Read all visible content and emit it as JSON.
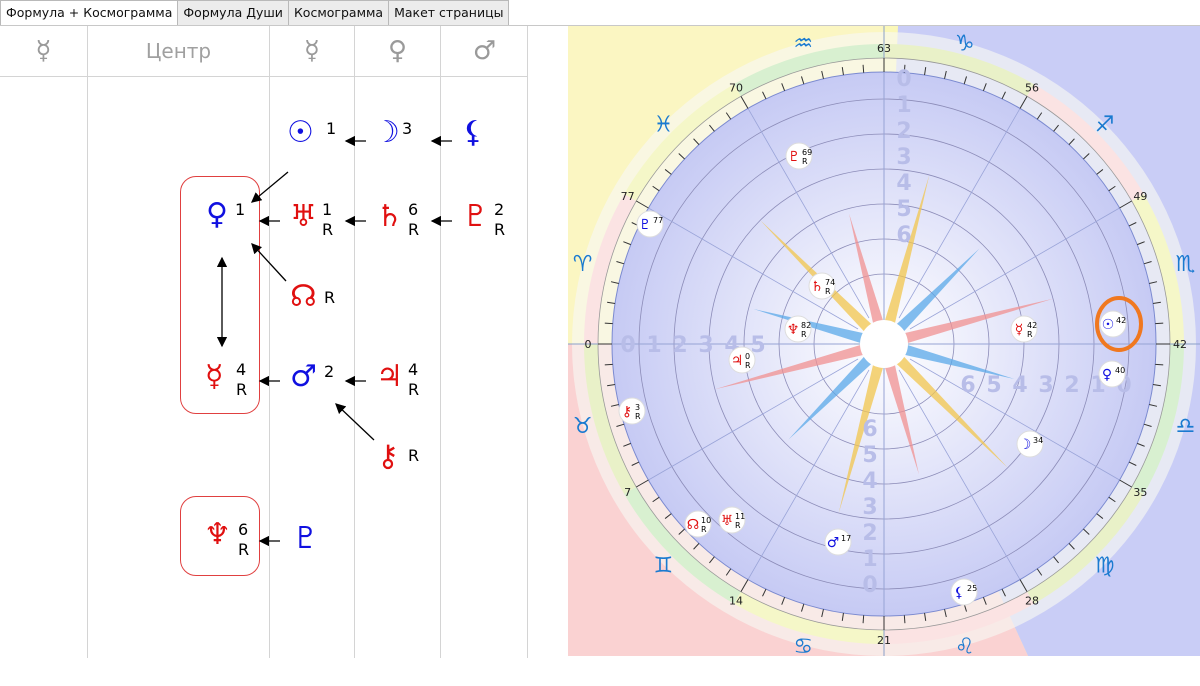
{
  "tabs": [
    {
      "label": "Формула + Космограмма",
      "active": true
    },
    {
      "label": "Формула Души",
      "active": false
    },
    {
      "label": "Космограмма",
      "active": false
    },
    {
      "label": "Макет страницы",
      "active": false
    }
  ],
  "formula": {
    "columns": [
      {
        "label": "☿",
        "kind": "icon"
      },
      {
        "label": "Центр",
        "kind": "text"
      },
      {
        "label": "☿",
        "kind": "icon"
      },
      {
        "label": "♀",
        "kind": "icon"
      },
      {
        "label": "♂",
        "kind": "icon"
      }
    ],
    "planets": {
      "sun": {
        "glyph": "☉",
        "num": "1",
        "r": ""
      },
      "moon": {
        "glyph": "☽",
        "num": "3",
        "r": ""
      },
      "lilith": {
        "glyph": "⚸",
        "num": "",
        "r": ""
      },
      "venus": {
        "glyph": "♀",
        "num": "1",
        "r": ""
      },
      "uranus": {
        "glyph": "♅",
        "num": "1",
        "r": "R"
      },
      "saturn": {
        "glyph": "♄",
        "num": "6",
        "r": "R"
      },
      "pluto_red": {
        "glyph": "♇",
        "num": "2",
        "r": "R"
      },
      "node": {
        "glyph": "☊",
        "num": "",
        "r": "R"
      },
      "mercury": {
        "glyph": "☿",
        "num": "4",
        "r": "R"
      },
      "mars": {
        "glyph": "♂",
        "num": "2",
        "r": ""
      },
      "jupiter": {
        "glyph": "♃",
        "num": "4",
        "r": "R"
      },
      "chiron": {
        "glyph": "⚷",
        "num": "",
        "r": "R"
      },
      "neptune": {
        "glyph": "♆",
        "num": "6",
        "r": "R"
      },
      "pluto_blue": {
        "glyph": "♇",
        "num": "",
        "r": ""
      }
    }
  },
  "chart": {
    "degree_labels": [
      "63",
      "56",
      "49",
      "42",
      "35",
      "28",
      "21",
      "14",
      "7",
      "0",
      "77",
      "70"
    ],
    "zodiac": [
      "♑",
      "♐",
      "♏",
      "♎",
      "♍",
      "♌",
      "♋",
      "♊",
      "♉",
      "♈",
      "♓",
      "♒"
    ],
    "planet_labels": [
      {
        "glyph": "♇",
        "deg": "69",
        "r": "R",
        "color": "#e01010"
      },
      {
        "glyph": "♇",
        "deg": "77",
        "r": "",
        "color": "#1010e0"
      },
      {
        "glyph": "♄",
        "deg": "74",
        "r": "R",
        "color": "#e01010"
      },
      {
        "glyph": "♆",
        "deg": "82",
        "r": "R",
        "color": "#e01010"
      },
      {
        "glyph": "♃",
        "deg": "0",
        "r": "R",
        "color": "#e01010"
      },
      {
        "glyph": "⚷",
        "deg": "3",
        "r": "R",
        "color": "#e01010"
      },
      {
        "glyph": "☊",
        "deg": "10",
        "r": "R",
        "color": "#e01010"
      },
      {
        "glyph": "♅",
        "deg": "11",
        "r": "R",
        "color": "#e01010"
      },
      {
        "glyph": "♂",
        "deg": "17",
        "r": "",
        "color": "#1010e0"
      },
      {
        "glyph": "⚸",
        "deg": "25",
        "r": "",
        "color": "#1010e0"
      },
      {
        "glyph": "☽",
        "deg": "34",
        "r": "",
        "color": "#1010e0"
      },
      {
        "glyph": "♀",
        "deg": "40",
        "r": "",
        "color": "#1010e0"
      },
      {
        "glyph": "☉",
        "deg": "42",
        "r": "",
        "color": "#1010e0"
      },
      {
        "glyph": "☿",
        "deg": "42",
        "r": "R",
        "color": "#e01010"
      }
    ],
    "ring_numbers_left": [
      "0",
      "1",
      "2",
      "3",
      "4",
      "5"
    ],
    "ring_numbers_right": [
      "6",
      "5",
      "4",
      "3",
      "2",
      "1",
      "0"
    ],
    "ring_numbers_top": [
      "0",
      "1",
      "2",
      "3",
      "4",
      "5",
      "6"
    ],
    "ring_numbers_bottom": [
      "6",
      "5",
      "4",
      "3",
      "2",
      "1",
      "0"
    ],
    "colors": {
      "highlight": "#f07820",
      "blue_zone": "#c9cdf6",
      "yellow": "#fbf6a8",
      "pink": "#fad3d3"
    }
  }
}
